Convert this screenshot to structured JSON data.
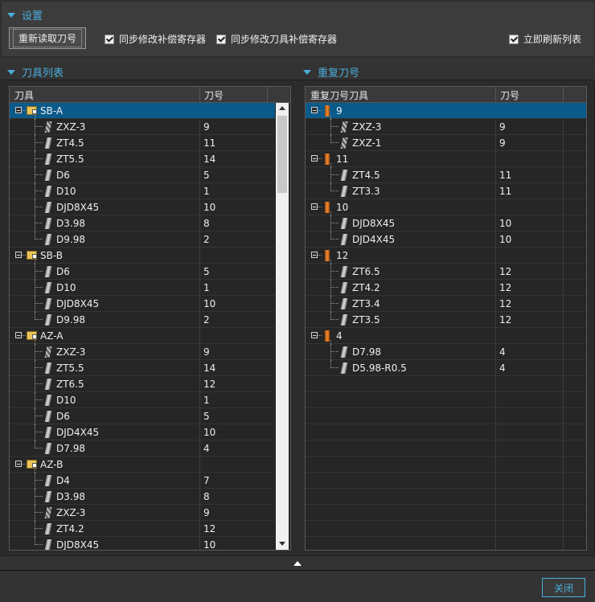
{
  "settings": {
    "title": "设置",
    "reload_button": "重新读取刀号",
    "checkboxes": [
      {
        "label": "同步修改补偿寄存器",
        "checked": true
      },
      {
        "label": "同步修改刀具补偿寄存器",
        "checked": true
      },
      {
        "label": "立即刷新列表",
        "checked": true
      }
    ]
  },
  "tool_list": {
    "title": "刀具列表",
    "columns": [
      "刀具",
      "刀号"
    ],
    "rows": [
      {
        "type": "group",
        "label": "SB-A",
        "value": "",
        "selected": true
      },
      {
        "type": "item",
        "label": "ZXZ-3",
        "value": "9",
        "icon": "drill",
        "last": false
      },
      {
        "type": "item",
        "label": "ZT4.5",
        "value": "11",
        "icon": "tool",
        "last": false
      },
      {
        "type": "item",
        "label": "ZT5.5",
        "value": "14",
        "icon": "tool",
        "last": false
      },
      {
        "type": "item",
        "label": "D6",
        "value": "5",
        "icon": "tool",
        "last": false
      },
      {
        "type": "item",
        "label": "D10",
        "value": "1",
        "icon": "tool",
        "last": false
      },
      {
        "type": "item",
        "label": "DJD8X45",
        "value": "10",
        "icon": "tool",
        "last": false
      },
      {
        "type": "item",
        "label": "D3.98",
        "value": "8",
        "icon": "tool",
        "last": false
      },
      {
        "type": "item",
        "label": "D9.98",
        "value": "2",
        "icon": "tool",
        "last": true
      },
      {
        "type": "group",
        "label": "SB-B",
        "value": ""
      },
      {
        "type": "item",
        "label": "D6",
        "value": "5",
        "icon": "tool",
        "last": false
      },
      {
        "type": "item",
        "label": "D10",
        "value": "1",
        "icon": "tool",
        "last": false
      },
      {
        "type": "item",
        "label": "DJD8X45",
        "value": "10",
        "icon": "tool",
        "last": false
      },
      {
        "type": "item",
        "label": "D9.98",
        "value": "2",
        "icon": "tool",
        "last": true
      },
      {
        "type": "group",
        "label": "AZ-A",
        "value": ""
      },
      {
        "type": "item",
        "label": "ZXZ-3",
        "value": "9",
        "icon": "drill",
        "last": false
      },
      {
        "type": "item",
        "label": "ZT5.5",
        "value": "14",
        "icon": "tool",
        "last": false
      },
      {
        "type": "item",
        "label": "ZT6.5",
        "value": "12",
        "icon": "tool",
        "last": false
      },
      {
        "type": "item",
        "label": "D10",
        "value": "1",
        "icon": "tool",
        "last": false
      },
      {
        "type": "item",
        "label": "D6",
        "value": "5",
        "icon": "tool",
        "last": false
      },
      {
        "type": "item",
        "label": "DJD4X45",
        "value": "10",
        "icon": "tool",
        "last": false
      },
      {
        "type": "item",
        "label": "D7.98",
        "value": "4",
        "icon": "tool",
        "last": true
      },
      {
        "type": "group",
        "label": "AZ-B",
        "value": ""
      },
      {
        "type": "item",
        "label": "D4",
        "value": "7",
        "icon": "tool",
        "last": false
      },
      {
        "type": "item",
        "label": "D3.98",
        "value": "8",
        "icon": "tool",
        "last": false
      },
      {
        "type": "item",
        "label": "ZXZ-3",
        "value": "9",
        "icon": "drill",
        "last": false
      },
      {
        "type": "item",
        "label": "ZT4.2",
        "value": "12",
        "icon": "tool",
        "last": false
      },
      {
        "type": "item",
        "label": "DJD8X45",
        "value": "10",
        "icon": "tool",
        "last": true
      }
    ]
  },
  "duplicate_list": {
    "title": "重复刀号",
    "columns": [
      "重复刀号刀具",
      "刀号"
    ],
    "rows": [
      {
        "type": "group",
        "label": "9",
        "value": "",
        "selected": true
      },
      {
        "type": "item",
        "label": "ZXZ-3",
        "value": "9",
        "icon": "drill",
        "last": false
      },
      {
        "type": "item",
        "label": "ZXZ-1",
        "value": "9",
        "icon": "drill",
        "last": true
      },
      {
        "type": "group",
        "label": "11",
        "value": ""
      },
      {
        "type": "item",
        "label": "ZT4.5",
        "value": "11",
        "icon": "tool",
        "last": false
      },
      {
        "type": "item",
        "label": "ZT3.3",
        "value": "11",
        "icon": "tool",
        "last": true
      },
      {
        "type": "group",
        "label": "10",
        "value": ""
      },
      {
        "type": "item",
        "label": "DJD8X45",
        "value": "10",
        "icon": "tool",
        "last": false
      },
      {
        "type": "item",
        "label": "DJD4X45",
        "value": "10",
        "icon": "tool",
        "last": true
      },
      {
        "type": "group",
        "label": "12",
        "value": ""
      },
      {
        "type": "item",
        "label": "ZT6.5",
        "value": "12",
        "icon": "tool",
        "last": false
      },
      {
        "type": "item",
        "label": "ZT4.2",
        "value": "12",
        "icon": "tool",
        "last": false
      },
      {
        "type": "item",
        "label": "ZT3.4",
        "value": "12",
        "icon": "tool",
        "last": false
      },
      {
        "type": "item",
        "label": "ZT3.5",
        "value": "12",
        "icon": "tool",
        "last": true
      },
      {
        "type": "group",
        "label": "4",
        "value": ""
      },
      {
        "type": "item",
        "label": "D7.98",
        "value": "4",
        "icon": "tool",
        "last": false
      },
      {
        "type": "item",
        "label": "D5.98-R0.5",
        "value": "4",
        "icon": "tool",
        "last": true
      }
    ]
  },
  "footer": {
    "close_button": "关闭"
  }
}
